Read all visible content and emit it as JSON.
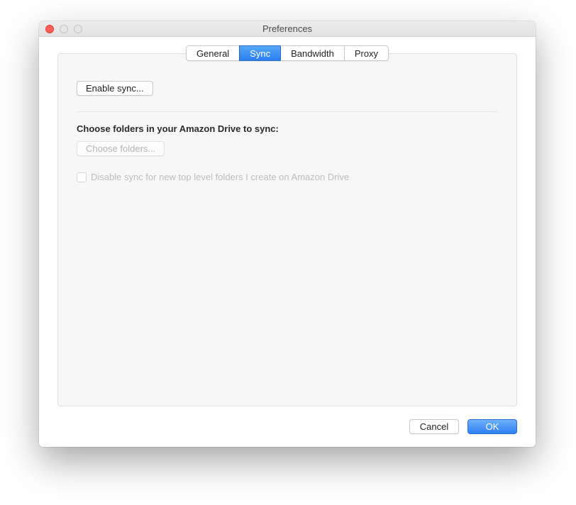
{
  "window": {
    "title": "Preferences"
  },
  "tabs": {
    "general": "General",
    "sync": "Sync",
    "bandwidth": "Bandwidth",
    "proxy": "Proxy",
    "active": "sync"
  },
  "sync_panel": {
    "enable_button": "Enable sync...",
    "choose_label": "Choose folders in your Amazon Drive to sync:",
    "choose_button": "Choose folders...",
    "disable_checkbox_label": "Disable sync for new top level folders I create on Amazon Drive"
  },
  "footer": {
    "cancel": "Cancel",
    "ok": "OK"
  }
}
